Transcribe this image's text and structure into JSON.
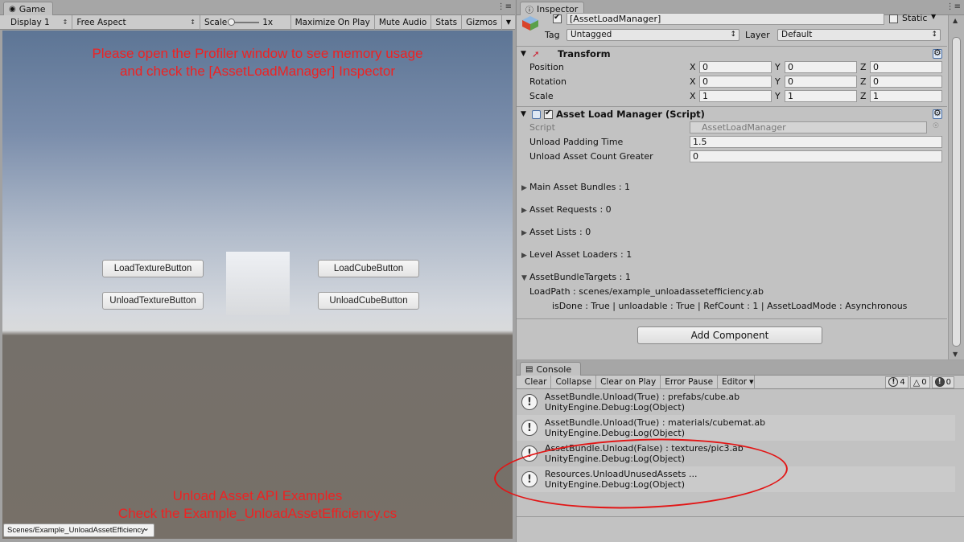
{
  "game": {
    "tab_label": "Game",
    "toolbar": {
      "display": "Display 1",
      "aspect": "Free Aspect",
      "scale_label": "Scale",
      "scale_value": "1x",
      "maximize": "Maximize On Play",
      "mute": "Mute Audio",
      "stats": "Stats",
      "gizmos": "Gizmos"
    },
    "message_top_1": "Please open the Profiler window to see memory usage",
    "message_top_2": "and check the [AssetLoadManager] Inspector",
    "buttons": {
      "load_texture": "LoadTextureButton",
      "unload_texture": "UnloadTextureButton",
      "load_cube": "LoadCubeButton",
      "unload_cube": "UnloadCubeButton"
    },
    "message_bottom_1": "Unload Asset API Examples",
    "message_bottom_2": "Check the Example_UnloadAssetEfficiency.cs",
    "scene_selector": "Scenes/Example_UnloadAssetEfficiency"
  },
  "inspector": {
    "tab_label": "Inspector",
    "object_name": "[AssetLoadManager]",
    "static_label": "Static",
    "tag_label": "Tag",
    "tag_value": "Untagged",
    "layer_label": "Layer",
    "layer_value": "Default",
    "transform": {
      "title": "Transform",
      "position_label": "Position",
      "rotation_label": "Rotation",
      "scale_label": "Scale",
      "x": "X",
      "y": "Y",
      "z": "Z",
      "position": [
        "0",
        "0",
        "0"
      ],
      "rotation": [
        "0",
        "0",
        "0"
      ],
      "scale": [
        "1",
        "1",
        "1"
      ]
    },
    "script_component": {
      "title": "Asset Load Manager (Script)",
      "script_label": "Script",
      "script_value": "AssetLoadManager",
      "padding_label": "Unload Padding Time",
      "padding_value": "1.5",
      "count_label": "Unload Asset Count Greater",
      "count_value": "0"
    },
    "foldouts": {
      "main_bundles": "Main Asset Bundles : 1",
      "requests": "Asset Requests : 0",
      "lists": "Asset Lists : 0",
      "level_loaders": "Level Asset Loaders : 1",
      "targets": "AssetBundleTargets : 1",
      "load_path": "LoadPath : scenes/example_unloadassetefficiency.ab",
      "details": "isDone : True | unloadable : True | RefCount : 1 | AssetLoadMode : Asynchronous"
    },
    "add_component": "Add Component"
  },
  "console": {
    "tab_label": "Console",
    "toolbar": {
      "clear": "Clear",
      "collapse": "Collapse",
      "clear_on_play": "Clear on Play",
      "error_pause": "Error Pause",
      "editor": "Editor",
      "info_count": "4",
      "warning_count": "0",
      "error_count": "0"
    },
    "logs": [
      {
        "line1": "AssetBundle.Unload(True) : prefabs/cube.ab",
        "line2": "UnityEngine.Debug:Log(Object)"
      },
      {
        "line1": "AssetBundle.Unload(True) : materials/cubemat.ab",
        "line2": "UnityEngine.Debug:Log(Object)"
      },
      {
        "line1": "AssetBundle.Unload(False) : textures/pic3.ab",
        "line2": "UnityEngine.Debug:Log(Object)"
      },
      {
        "line1": "Resources.UnloadUnusedAssets ...",
        "line2": "UnityEngine.Debug:Log(Object)"
      }
    ]
  },
  "colors": {
    "annotation": "#e21616",
    "message_text": "#ee2222",
    "panel_bg": "#c2c2c2"
  }
}
